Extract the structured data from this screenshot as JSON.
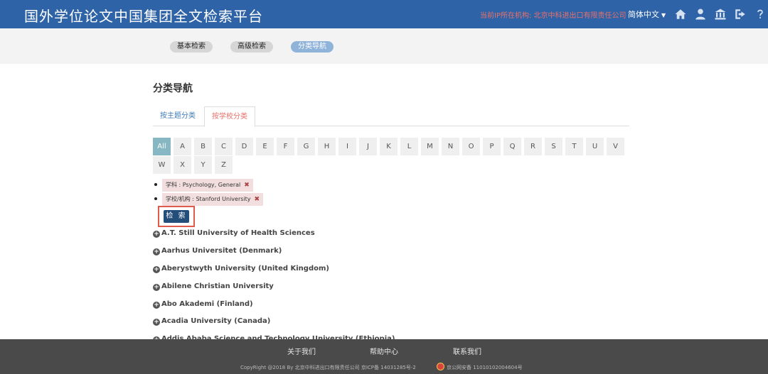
{
  "header": {
    "title": "国外学位论文中国集团全文检索平台",
    "ip_info": "当前IP所在机构: 北京中科进出口有限责任公司",
    "language": "简体中文",
    "icons": [
      "home-icon",
      "user-icon",
      "institution-icon",
      "logout-icon",
      "help-icon"
    ]
  },
  "nav": {
    "basic": "基本检索",
    "advanced": "高级检索",
    "category": "分类导航"
  },
  "page_title": "分类导航",
  "tabs": {
    "subject": "按主题分类",
    "school": "按学校分类"
  },
  "letters": [
    "All",
    "A",
    "B",
    "C",
    "D",
    "E",
    "F",
    "G",
    "H",
    "I",
    "J",
    "K",
    "L",
    "M",
    "N",
    "O",
    "P",
    "Q",
    "R",
    "S",
    "T",
    "U",
    "V",
    "W",
    "X",
    "Y",
    "Z"
  ],
  "filters": [
    {
      "text": "学科 : Psychology, General",
      "remove": "✖"
    },
    {
      "text": "学校/机构 : Stanford University",
      "remove": "✖"
    }
  ],
  "search_button": "检 索",
  "universities": [
    "A.T. Still University of Health Sciences",
    "Aarhus Universitet (Denmark)",
    "Aberystwyth University (United Kingdom)",
    "Abilene Christian University",
    "Abo Akademi (Finland)",
    "Acadia University (Canada)",
    "Addis Ababa Science and Technology University (Ethiopia)"
  ],
  "footer": {
    "about": "关于我们",
    "help": "帮助中心",
    "contact": "联系我们",
    "copyright": "CopyRight @2018 By 北京中科进出口有限责任公司 京ICP备 14031285号-2",
    "beian": "京公网安备 11010102004604号"
  },
  "colors": {
    "header_bg": "#2f63a8",
    "active_letter": "#86b7c2",
    "search_button": "#234e7a",
    "highlight_border": "#e05a4e"
  }
}
